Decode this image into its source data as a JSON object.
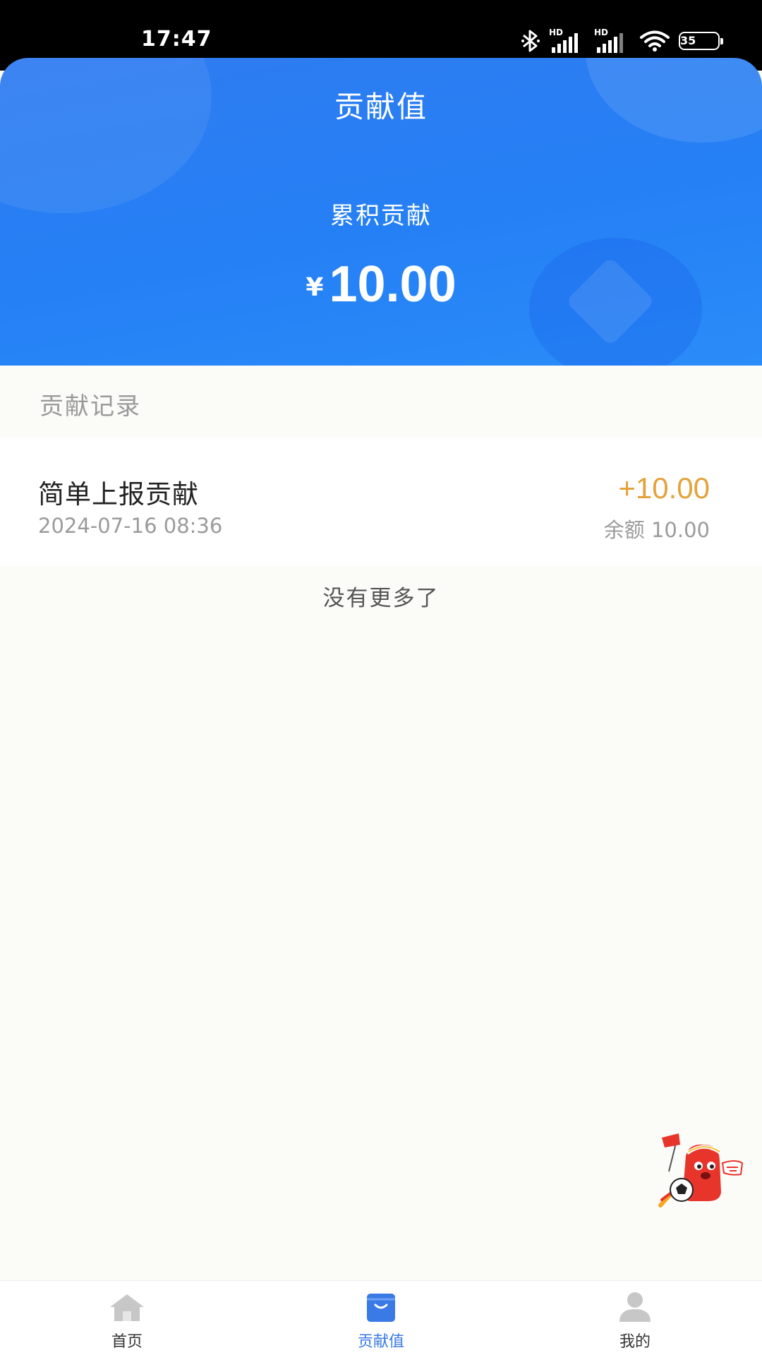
{
  "status_bar": {
    "time": "17:47",
    "battery": "35",
    "icons": [
      "bluetooth-icon",
      "hd-signal-icon",
      "hd-signal-icon",
      "wifi-icon",
      "battery-icon"
    ]
  },
  "header": {
    "title": "贡献值",
    "total_label": "累积贡献",
    "currency_symbol": "¥",
    "total_amount": "10.00"
  },
  "records": {
    "section_title": "贡献记录",
    "items": [
      {
        "name": "简单上报贡献",
        "time": "2024-07-16 08:36",
        "amount": "+10.00",
        "balance": "余额 10.00"
      }
    ],
    "end_text": "没有更多了"
  },
  "tabbar": {
    "tabs": [
      {
        "label": "首页",
        "icon": "home-icon",
        "active": false
      },
      {
        "label": "贡献值",
        "icon": "wallet-icon",
        "active": true
      },
      {
        "label": "我的",
        "icon": "user-icon",
        "active": false
      }
    ]
  },
  "colors": {
    "header_blue": "#2580f5",
    "amount_orange": "#e4a23a",
    "active_tab": "#3a7ae6",
    "inactive_icon": "#c7c7c7"
  }
}
